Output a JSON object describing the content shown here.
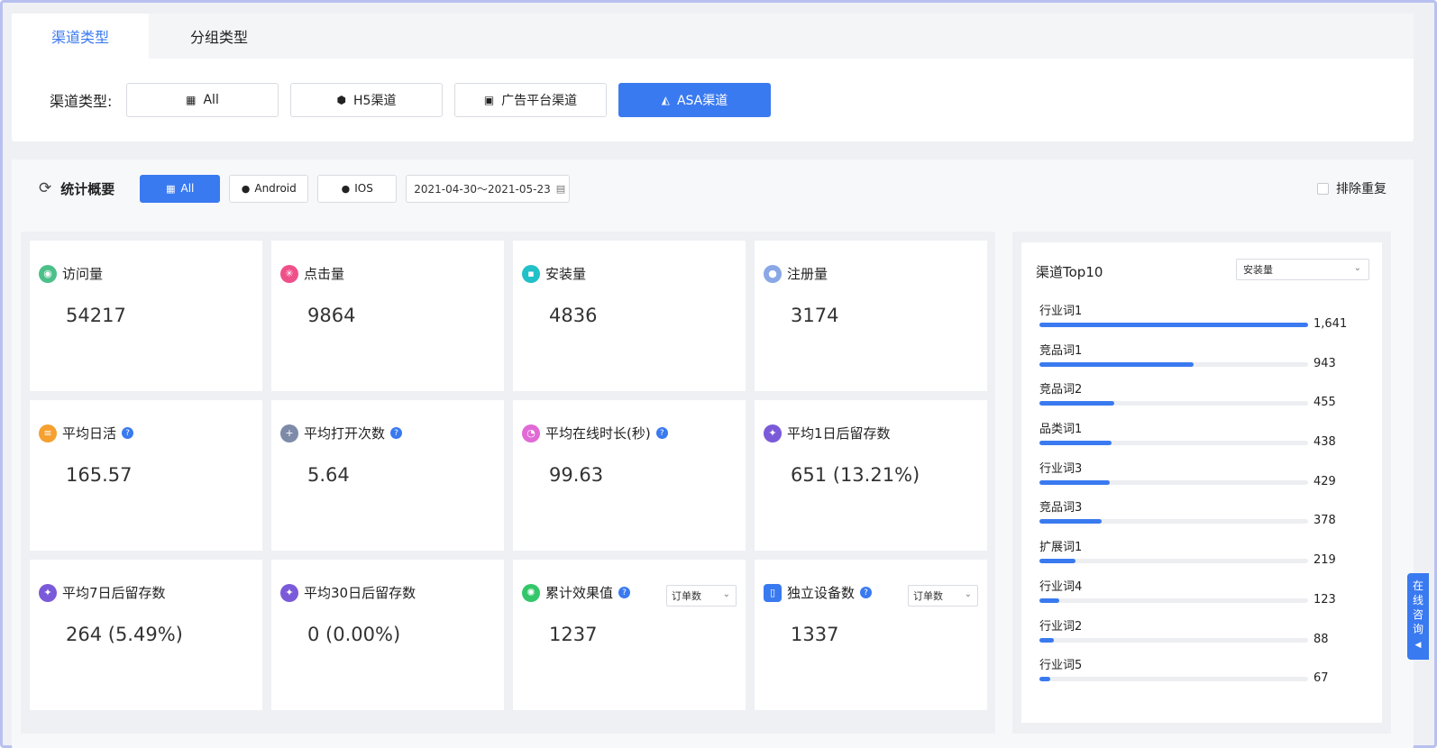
{
  "tabs": [
    {
      "label": "渠道类型",
      "active": true
    },
    {
      "label": "分组类型",
      "active": false
    }
  ],
  "channel_type": {
    "label": "渠道类型:",
    "options": [
      {
        "label": "All",
        "icon": "grid-icon",
        "active": false
      },
      {
        "label": "H5渠道",
        "icon": "html5-icon",
        "active": false
      },
      {
        "label": "广告平台渠道",
        "icon": "ad-icon",
        "active": false
      },
      {
        "label": "ASA渠道",
        "icon": "app-store-icon",
        "active": true
      }
    ]
  },
  "stats": {
    "title": "统计概要",
    "platforms": [
      {
        "label": "All",
        "active": true
      },
      {
        "label": "Android",
        "active": false
      },
      {
        "label": "IOS",
        "active": false
      }
    ],
    "date_range": "2021-04-30～2021-05-23",
    "dedupe_label": "排除重复",
    "dedupe_checked": false
  },
  "metrics": [
    {
      "label": "访问量",
      "value": "54217",
      "icon": "eye-icon",
      "color": "#4cc08a"
    },
    {
      "label": "点击量",
      "value": "9864",
      "icon": "click-icon",
      "color": "#f0508a"
    },
    {
      "label": "安装量",
      "value": "4836",
      "icon": "install-icon",
      "color": "#22c0c8"
    },
    {
      "label": "注册量",
      "value": "3174",
      "icon": "user-icon",
      "color": "#8aa7e6"
    },
    {
      "label": "平均日活",
      "value": "165.57",
      "icon": "stack-icon",
      "color": "#f5a030",
      "help": true
    },
    {
      "label": "平均打开次数",
      "value": "5.64",
      "icon": "plus-icon",
      "color": "#7d8aa8",
      "help": true
    },
    {
      "label": "平均在线时长(秒)",
      "value": "99.63",
      "icon": "clock-icon",
      "color": "#e06ad6",
      "help": true
    },
    {
      "label": "平均1日后留存数",
      "value": "651 (13.21%)",
      "icon": "retention-icon",
      "color": "#7a5ad8"
    },
    {
      "label": "平均7日后留存数",
      "value": "264 (5.49%)",
      "icon": "retention-icon",
      "color": "#7a5ad8"
    },
    {
      "label": "平均30日后留存数",
      "value": "0 (0.00%)",
      "icon": "retention-icon",
      "color": "#7a5ad8"
    },
    {
      "label": "累计效果值",
      "value": "1237",
      "icon": "effect-icon",
      "color": "#34c76a",
      "help": true,
      "select": "订单数"
    },
    {
      "label": "独立设备数",
      "value": "1337",
      "icon": "device-icon",
      "color": "#3a7af0",
      "help": true,
      "select": "订单数"
    }
  ],
  "top10": {
    "title": "渠道Top10",
    "select": "安装量",
    "items": [
      {
        "name": "行业词1",
        "value": 1641,
        "label": "1,641"
      },
      {
        "name": "竞品词1",
        "value": 943,
        "label": "943"
      },
      {
        "name": "竞品词2",
        "value": 455,
        "label": "455"
      },
      {
        "name": "品类词1",
        "value": 438,
        "label": "438"
      },
      {
        "name": "行业词3",
        "value": 429,
        "label": "429"
      },
      {
        "name": "竞品词3",
        "value": 378,
        "label": "378"
      },
      {
        "name": "扩展词1",
        "value": 219,
        "label": "219"
      },
      {
        "name": "行业词4",
        "value": 123,
        "label": "123"
      },
      {
        "name": "行业词2",
        "value": 88,
        "label": "88"
      },
      {
        "name": "行业词5",
        "value": 67,
        "label": "67"
      }
    ]
  },
  "consult": {
    "label": "在线咨询",
    "arrow": "◀"
  }
}
